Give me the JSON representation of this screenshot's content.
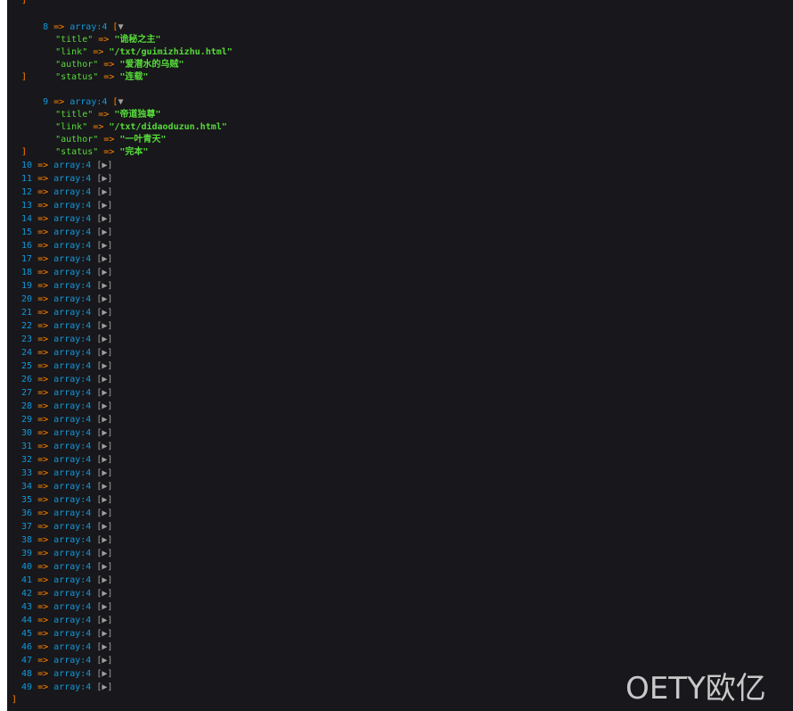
{
  "dump": {
    "top_bracket": "]",
    "expanded": [
      {
        "index": "8",
        "arrow": "=>",
        "type": "array:4",
        "open": "[",
        "toggle": "▼",
        "fields": [
          {
            "key": "\"title\"",
            "arrow": "=>",
            "value": "\"诡秘之主\""
          },
          {
            "key": "\"link\"",
            "arrow": "=>",
            "value": "\"/txt/guimizhizhu.html\""
          },
          {
            "key": "\"author\"",
            "arrow": "=>",
            "value": "\"爱潜水的乌贼\""
          },
          {
            "key": "\"status\"",
            "arrow": "=>",
            "value": "\"连载\""
          }
        ],
        "close": "]"
      },
      {
        "index": "9",
        "arrow": "=>",
        "type": "array:4",
        "open": "[",
        "toggle": "▼",
        "fields": [
          {
            "key": "\"title\"",
            "arrow": "=>",
            "value": "\"帝道独尊\""
          },
          {
            "key": "\"link\"",
            "arrow": "=>",
            "value": "\"/txt/didaoduzun.html\""
          },
          {
            "key": "\"author\"",
            "arrow": "=>",
            "value": "\"一叶青天\""
          },
          {
            "key": "\"status\"",
            "arrow": "=>",
            "value": "\"完本\""
          }
        ],
        "close": "]"
      }
    ],
    "collapsed_arrow": "=>",
    "collapsed_type": "array:4",
    "collapsed_toggle": "[▶]",
    "collapsed_indices": [
      "10",
      "11",
      "12",
      "13",
      "14",
      "15",
      "16",
      "17",
      "18",
      "19",
      "20",
      "21",
      "22",
      "23",
      "24",
      "25",
      "26",
      "27",
      "28",
      "29",
      "30",
      "31",
      "32",
      "33",
      "34",
      "35",
      "36",
      "37",
      "38",
      "39",
      "40",
      "41",
      "42",
      "43",
      "44",
      "45",
      "46",
      "47",
      "48",
      "49"
    ],
    "bottom_bracket": "]"
  },
  "watermark": "OETY欧亿",
  "colors": {
    "background": "#18171b",
    "index": "#1299da",
    "arrow": "#ff8400",
    "string": "#56db3a",
    "toggle": "#a0a0a0"
  }
}
